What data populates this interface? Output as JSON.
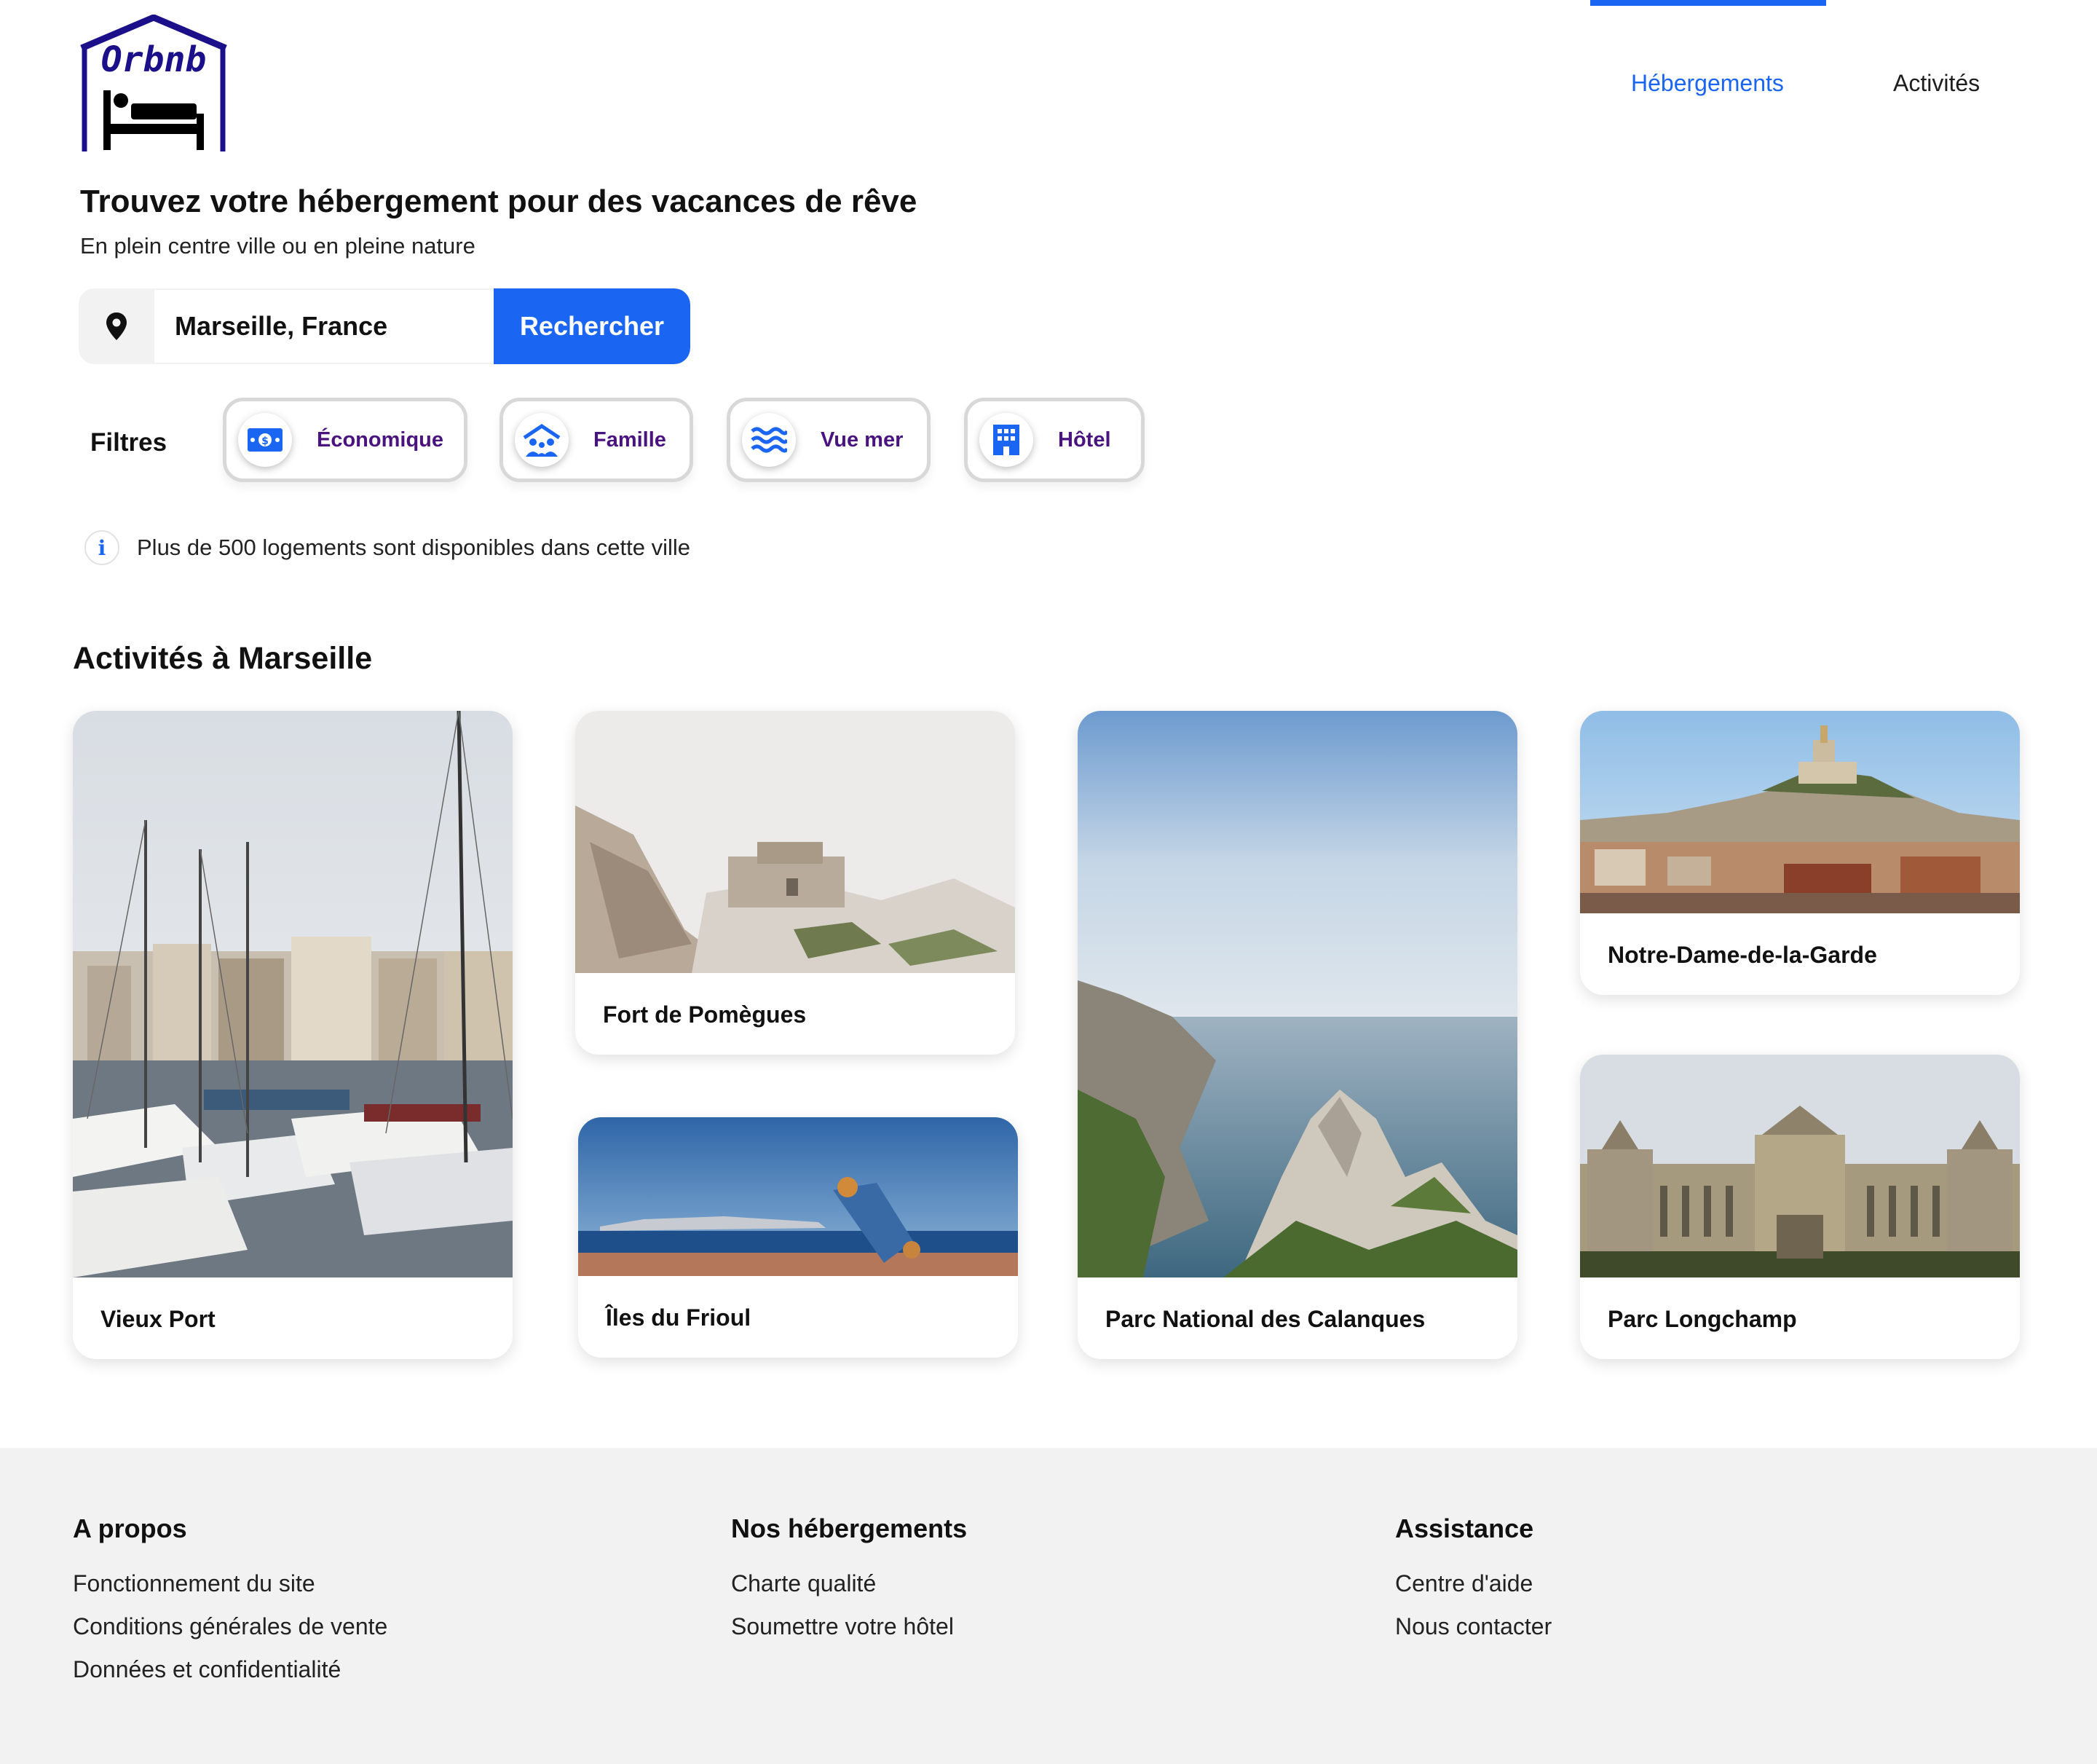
{
  "header": {
    "logo_text": "Orbnb",
    "nav": [
      {
        "label": "Hébergements",
        "active": true
      },
      {
        "label": "Activités",
        "active": false
      }
    ]
  },
  "hero": {
    "title": "Trouvez votre hébergement pour des vacances de rêve",
    "subtitle": "En plein centre ville ou en pleine nature"
  },
  "search": {
    "value": "Marseille, France",
    "button_label": "Rechercher",
    "icon": "map-pin-icon"
  },
  "filters": {
    "label": "Filtres",
    "items": [
      {
        "label": "Économique",
        "icon": "money-icon"
      },
      {
        "label": "Famille",
        "icon": "family-icon"
      },
      {
        "label": "Vue mer",
        "icon": "waves-icon"
      },
      {
        "label": "Hôtel",
        "icon": "hotel-icon"
      }
    ]
  },
  "info": {
    "text": "Plus de 500 logements sont disponibles dans cette ville",
    "icon": "info-icon"
  },
  "activities": {
    "title": "Activités à Marseille",
    "cards": [
      {
        "label": "Vieux Port"
      },
      {
        "label": "Fort de Pomègues"
      },
      {
        "label": "Îles du Frioul"
      },
      {
        "label": "Parc National des Calanques"
      },
      {
        "label": "Notre-Dame-de-la-Garde"
      },
      {
        "label": "Parc Longchamp"
      }
    ]
  },
  "footer": {
    "columns": [
      {
        "title": "A propos",
        "links": [
          "Fonctionnement du site",
          "Conditions générales de vente",
          "Données et confidentialité"
        ]
      },
      {
        "title": "Nos hébergements",
        "links": [
          "Charte qualité",
          "Soumettre votre hôtel"
        ]
      },
      {
        "title": "Assistance",
        "links": [
          "Centre d'aide",
          "Nous contacter"
        ]
      }
    ]
  },
  "colors": {
    "primary": "#1a66f2",
    "logo": "#1c0f8a",
    "filter_text": "#4a1480",
    "footer_bg": "#f2f2f2"
  }
}
